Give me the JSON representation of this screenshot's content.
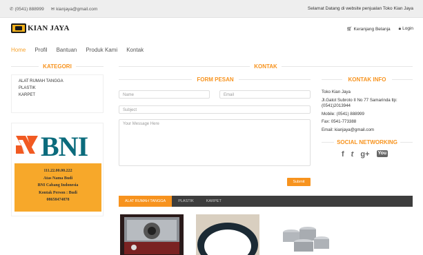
{
  "topbar": {
    "phone": "(0541) 888999",
    "email": "kianjaya@gmail.com",
    "welcome": "Selamat Datang di website penjualan Toko Kian Jaya"
  },
  "header": {
    "logo_text": "KIAN JAYA",
    "cart": "Keranjang Belanja",
    "login": "Login"
  },
  "nav": [
    "Home",
    "Profil",
    "Bantuan",
    "Produk Kami",
    "Kontak"
  ],
  "sidebar": {
    "title": "KATEGORI",
    "categories": [
      "ALAT RUMAH TANGGA",
      "PLASTIK",
      "KARPET"
    ],
    "bank": {
      "logo": "BNI",
      "account": "111.22.00.00.222",
      "name": "Atas Nama Budi",
      "branch": "BNI Cabang Indonesia",
      "contact": "Kontak Person : Budi",
      "phone": "08658474878"
    }
  },
  "main": {
    "title": "KONTAK",
    "form": {
      "title": "FORM PESAN",
      "name_placeholder": "Name",
      "email_placeholder": "Email",
      "subject_placeholder": "Subject",
      "message_placeholder": "Your Message Here",
      "submit": "Submit"
    },
    "info": {
      "title": "KONTAK INFO",
      "store": "Toko Kian Jaya",
      "address": "Jl.Gatot Subroto II No 77 Samarinda tlp:(0541)2013944",
      "mobile": "Mobile: (0541) 888999",
      "fax": "Fax: 0541-773388",
      "email": "Email: kianjaya@gmail.com"
    },
    "social": {
      "title": "SOCIAL NETWORKING",
      "icons": [
        "facebook-icon",
        "twitter-icon",
        "google-plus-icon",
        "youtube-icon"
      ],
      "glyphs": [
        "f",
        "t",
        "g+",
        "You"
      ]
    },
    "tabs": [
      "ALAT RUMAH TANGGA",
      "PLASTIK",
      "KARPET"
    ]
  },
  "colors": {
    "accent": "#f7931e",
    "bni_teal": "#0b6b7c",
    "bni_orange": "#f15a22",
    "card": "#f7a82a"
  }
}
